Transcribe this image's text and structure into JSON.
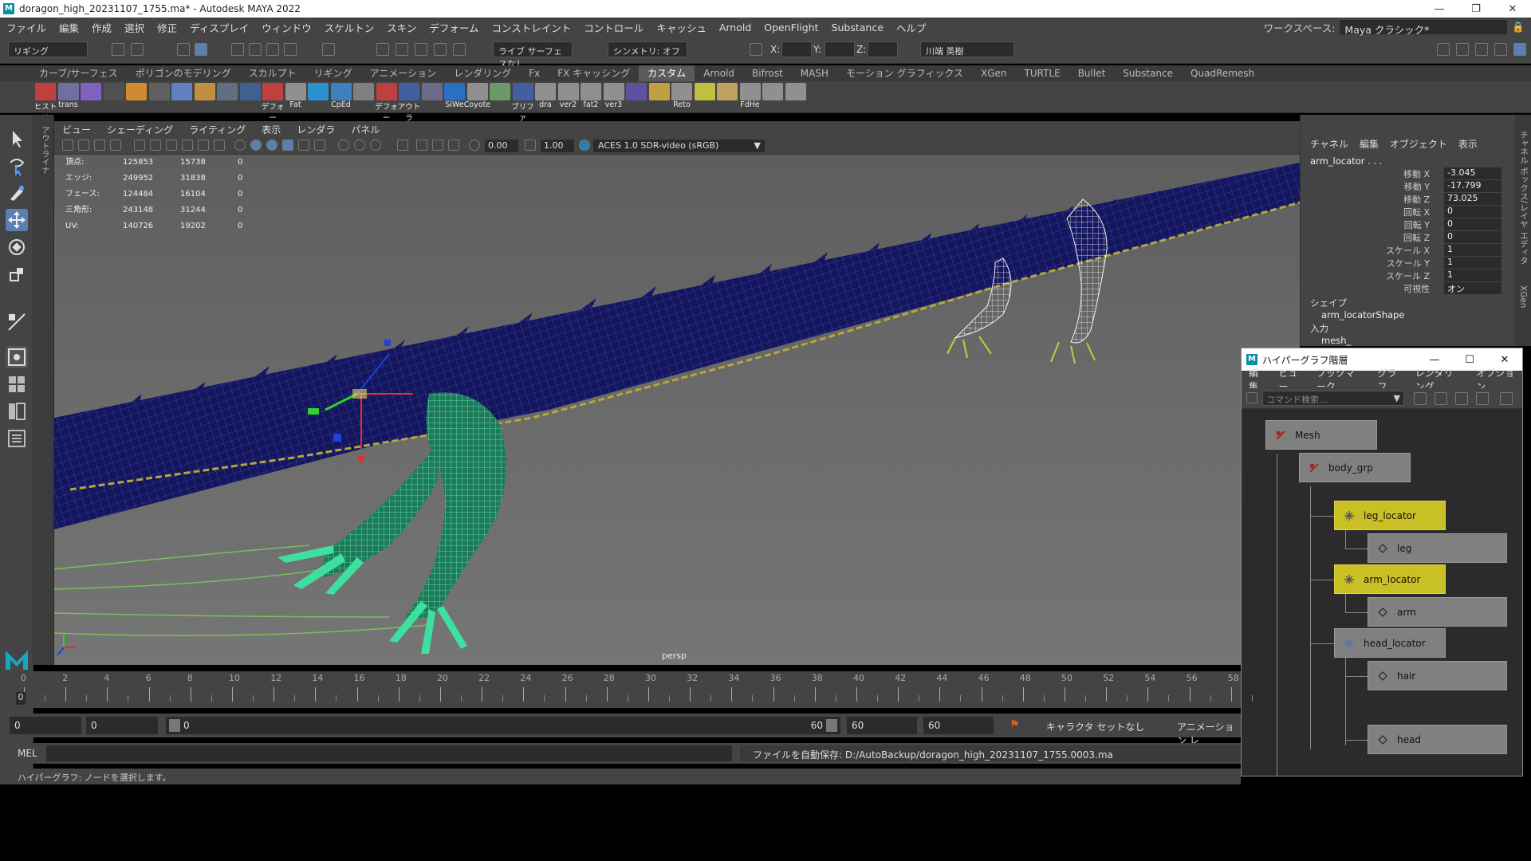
{
  "window": {
    "title": "doragon_high_20231107_1755.ma* - Autodesk MAYA 2022",
    "logo": "M"
  },
  "menubar": {
    "items": [
      "ファイル",
      "編集",
      "作成",
      "選択",
      "修正",
      "ディスプレイ",
      "ウィンドウ",
      "スケルトン",
      "スキン",
      "デフォーム",
      "コンストレイント",
      "コントロール",
      "キャッシュ",
      "Arnold",
      "OpenFlight",
      "Substance",
      "ヘルプ"
    ],
    "workspace_label": "ワークスペース:",
    "workspace_value": "Maya クラシック*"
  },
  "statusline": {
    "mode": "リギング",
    "live_surface": "ライブ サーフェスなし",
    "symmetry": "シンメトリ: オフ",
    "x_label": "X:",
    "y_label": "Y:",
    "z_label": "Z:",
    "user": "川端 英樹"
  },
  "shelf": {
    "tabs": [
      "カーブ/サーフェス",
      "ポリゴンのモデリング",
      "スカルプト",
      "リギング",
      "アニメーション",
      "レンダリング",
      "Fx",
      "FX キャッシング",
      "カスタム",
      "Arnold",
      "Bifrost",
      "MASH",
      "モーション グラフィックス",
      "XGen",
      "TURTLE",
      "Bullet",
      "Substance",
      "QuadRemesh"
    ],
    "active_tab": "カスタム",
    "buttons": [
      "ヒストリ",
      "trans",
      "",
      "",
      "",
      "",
      "",
      "",
      "",
      "",
      "デフォー",
      "Fat",
      "",
      "CpEd",
      "",
      "デフォー",
      "アウトラ",
      "",
      "SiWe",
      "Coyote",
      "",
      "ブリファ",
      "dra",
      "ver2",
      "fat2",
      "ver3",
      "",
      "",
      "Reto",
      "",
      "",
      "FdHe",
      "",
      ""
    ]
  },
  "viewport": {
    "menu": [
      "ビュー",
      "シェーディング",
      "ライティング",
      "表示",
      "レンダラ",
      "パネル"
    ],
    "exposure": "0.00",
    "gamma": "1.00",
    "color_space": "ACES 1.0 SDR-video (sRGB)",
    "camera_label": "persp",
    "hud": [
      {
        "label": "頂点:",
        "a": "125853",
        "b": "15738",
        "c": "0"
      },
      {
        "label": "エッジ:",
        "a": "249952",
        "b": "31838",
        "c": "0"
      },
      {
        "label": "フェース:",
        "a": "124484",
        "b": "16104",
        "c": "0"
      },
      {
        "label": "三角形:",
        "a": "243148",
        "b": "31244",
        "c": "0"
      },
      {
        "label": "UV:",
        "a": "140726",
        "b": "19202",
        "c": "0"
      }
    ]
  },
  "outliner_strip_label": "アウトライナ",
  "channel_box": {
    "menu": [
      "チャネル",
      "編集",
      "オブジェクト",
      "表示"
    ],
    "object": "arm_locator . . .",
    "attributes": [
      {
        "name": "移動 X",
        "value": "-3.045"
      },
      {
        "name": "移動 Y",
        "value": "-17.799"
      },
      {
        "name": "移動 Z",
        "value": "73.025"
      },
      {
        "name": "回転 X",
        "value": "0"
      },
      {
        "name": "回転 Y",
        "value": "0"
      },
      {
        "name": "回転 Z",
        "value": "0"
      },
      {
        "name": "スケール X",
        "value": "1"
      },
      {
        "name": "スケール Y",
        "value": "1"
      },
      {
        "name": "スケール Z",
        "value": "1"
      },
      {
        "name": "可視性",
        "value": "オン"
      }
    ],
    "shape_header": "シェイプ",
    "shape_name": "arm_locatorShape",
    "input_header": "入力",
    "input_name": "mesh_",
    "side_tabs": [
      "チャネル ボックス/レイヤ エディタ",
      "XGen"
    ]
  },
  "hypergraph": {
    "title": "ハイパーグラフ階層",
    "menu": [
      "編集",
      "ビュー",
      "ブックマーク",
      "グラフ",
      "レンダリング",
      "オプション"
    ],
    "search_placeholder": "コマンド検索...",
    "nodes": [
      {
        "label": "Mesh",
        "selected": false
      },
      {
        "label": "body_grp",
        "selected": false
      },
      {
        "label": "leg_locator",
        "selected": true
      },
      {
        "label": "leg",
        "selected": false
      },
      {
        "label": "arm_locator",
        "selected": true
      },
      {
        "label": "arm",
        "selected": false
      },
      {
        "label": "head_locator",
        "selected": false
      },
      {
        "label": "hair",
        "selected": false
      },
      {
        "label": "head",
        "selected": false
      }
    ]
  },
  "timeline": {
    "ticks": [
      "0",
      "2",
      "4",
      "6",
      "8",
      "10",
      "12",
      "14",
      "16",
      "18",
      "20",
      "22",
      "24",
      "26",
      "28",
      "30",
      "32",
      "34",
      "36",
      "38",
      "40",
      "42",
      "44",
      "46",
      "48",
      "50",
      "52",
      "54",
      "56",
      "58"
    ],
    "current_frame": "0"
  },
  "range": {
    "start": "0",
    "anim_start": "0",
    "slider_start": "0",
    "slider_end": "60",
    "anim_end": "60",
    "end": "60",
    "character_set": "キャラクタ セットなし",
    "anim_layer": "アニメーション レ"
  },
  "command_line": {
    "mode": "MEL",
    "result": "ファイルを自動保存: D:/AutoBackup/doragon_high_20231107_1755.0003.ma"
  },
  "help_line": "ハイパーグラフ: ノードを選択します。",
  "colors": {
    "ui_bg": "#444444",
    "field_bg": "#2b2b2b",
    "selected_node": "#c8c025",
    "wire_blue": "#1c1c7a",
    "wire_green": "#3ee0a0",
    "maya_teal": "#0c8ea4"
  }
}
